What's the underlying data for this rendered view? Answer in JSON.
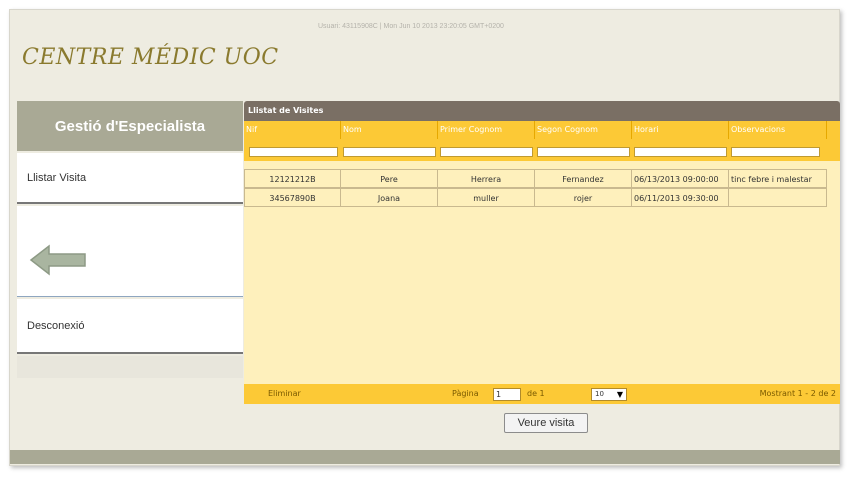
{
  "header": {
    "logo": "CENTRE MÉDIC UOC",
    "user_info": "Usuari: 43115908C | Mon Jun 10 2013 23:20:05 GMT+0200"
  },
  "sidebar": {
    "title": "Gestió d'Especialista",
    "items": [
      {
        "label": "Llistar Visita"
      },
      {
        "label": "Desconexió"
      }
    ],
    "back_icon": "left-arrow-icon"
  },
  "grid": {
    "caption": "Llistat de Visites",
    "columns": [
      "Nif",
      "Nom",
      "Primer Cognom",
      "Segon Cognom",
      "Horari",
      "Observacions"
    ],
    "rows": [
      [
        "12121212B",
        "Pere",
        "Herrera",
        "Fernandez",
        "06/13/2013 09:00:00",
        "tinc febre i malestar"
      ],
      [
        "34567890B",
        "Joana",
        "muller",
        "rojer",
        "06/11/2013 09:30:00",
        ""
      ]
    ],
    "pager": {
      "delete_label": "Eliminar",
      "page_label": "Pàgina",
      "page_value": "1",
      "of_label": "de 1",
      "rows_per_page": "10",
      "count_label": "Mostrant 1 - 2 de 2"
    }
  },
  "actions": {
    "view_label": "Veure visita"
  },
  "colors": {
    "accent": "#fcc936",
    "caption": "#7a6f64",
    "sidebar_head": "#a9a995",
    "body": "#fef0bc"
  }
}
